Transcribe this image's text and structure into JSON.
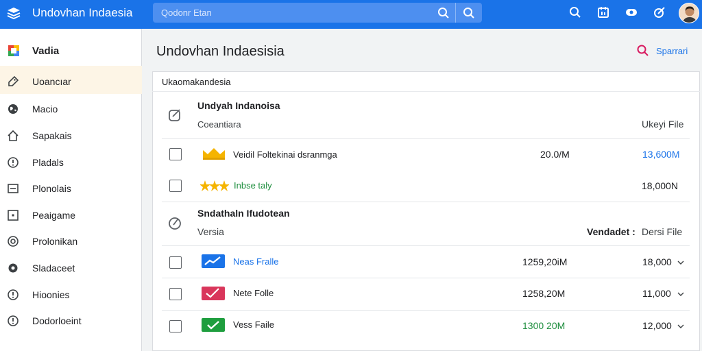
{
  "app": {
    "title": "Undovhan Indaesia"
  },
  "search": {
    "placeholder": "Qodonr Etan"
  },
  "sidebar": {
    "items": [
      {
        "label": "Vadia",
        "icon": "google-drive-logo-icon",
        "active": true
      },
      {
        "label": "Uoancıar",
        "icon": "tag-icon"
      },
      {
        "label": "Macio",
        "icon": "globe-icon"
      },
      {
        "label": "Sapakais",
        "icon": "home-icon"
      },
      {
        "label": "Pladals",
        "icon": "info-circle-icon"
      },
      {
        "label": "Plonolais",
        "icon": "list-box-icon"
      },
      {
        "label": "Peaigame",
        "icon": "square-dot-icon"
      },
      {
        "label": "Prolonikan",
        "icon": "settings-circle-icon"
      },
      {
        "label": "Sladaceet",
        "icon": "gear-icon"
      },
      {
        "label": "Hioonies",
        "icon": "info-circle-icon"
      },
      {
        "label": "Dodorloeint",
        "icon": "alert-circle-icon"
      }
    ]
  },
  "main": {
    "title": "Undovhan Indaesisia",
    "action_label": "Sparrari",
    "card_header": "Ukaomakandesia",
    "sections": [
      {
        "title": "Undyah Indanoisa",
        "col_left": "Coeantiara",
        "col_right": "Ukeyi File",
        "rows": [
          {
            "name": "Veidil Foltekinai dsranmga",
            "size": "20.0/M",
            "value": "13,600M",
            "icon": "crown-icon",
            "value_color": "#1a73e8",
            "name_color": "#202124"
          },
          {
            "name": "Inbse taly",
            "size": "",
            "value": "18,000N",
            "icon": "stars-icon",
            "value_color": "#202124",
            "name_color": "#1e8e3e"
          }
        ]
      },
      {
        "title": "Sndathaln Ifudotean",
        "col_left": "Versia",
        "col_mid": "Vendadet :",
        "col_right": "Dersi File",
        "rows": [
          {
            "name": "Neas Fralle",
            "size": "1259,20iM",
            "value": "18,000",
            "icon": "blue-chart-icon",
            "value_color": "#202124",
            "name_color": "#1a73e8",
            "size_color": "#202124"
          },
          {
            "name": "Nete Folle",
            "size": "1258,20M",
            "value": "11,000",
            "icon": "red-chart-icon",
            "value_color": "#202124",
            "name_color": "#202124",
            "size_color": "#202124"
          },
          {
            "name": "Vess Faile",
            "size": "1300 20M",
            "value": "12,000",
            "icon": "green-check-icon",
            "value_color": "#202124",
            "name_color": "#202124",
            "size_color": "#1e8e3e"
          }
        ]
      }
    ]
  }
}
